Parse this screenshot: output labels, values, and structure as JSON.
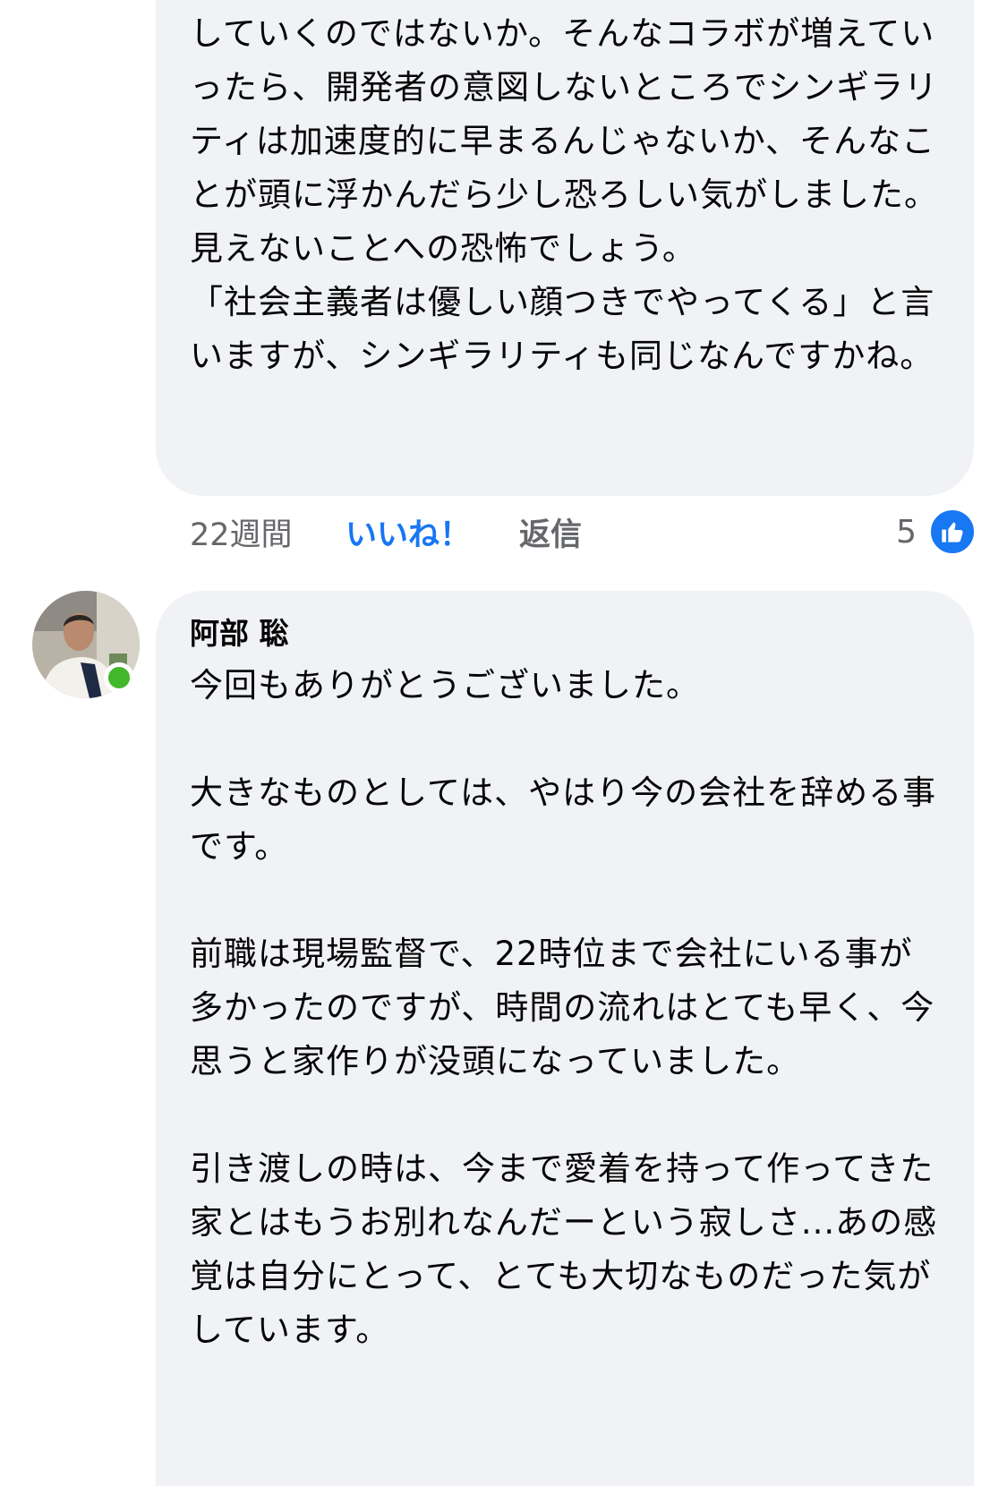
{
  "previous_comment": {
    "text": "していくのではないか。そんなコラボが増えていったら、開発者の意図しないところでシンギラリティは加速度的に早まるんじゃないか、そんなことが頭に浮かんだら少し恐ろしい気がしました。見えないことへの恐怖でしょう。\n「社会主義者は優しい顔つきでやってくる」と言いますが、シンギラリティも同じなんですかね。",
    "time": "22週間",
    "like_label": "いいね！",
    "reply_label": "返信",
    "reaction_count": "5",
    "reaction_icon": "thumbs-up-icon"
  },
  "comment": {
    "author": "阿部 聡",
    "online": true,
    "avatar_icon": "profile-photo",
    "text": "今回もありがとうございました。\n\n大きなものとしては、やはり今の会社を辞める事です。\n\n前職は現場監督で、22時位まで会社にいる事が多かったのですが、時間の流れはとても早く、今思うと家作りが没頭になっていました。\n\n引き渡しの時は、今まで愛着を持って作ってきた家とはもうお別れなんだーという寂しさ...あの感覚は自分にとって、とても大切なものだった気がしています。"
  },
  "colors": {
    "bubble": "#f0f2f5",
    "accent": "#1877f2",
    "secondary_text": "#65676b",
    "online": "#42b72a"
  }
}
